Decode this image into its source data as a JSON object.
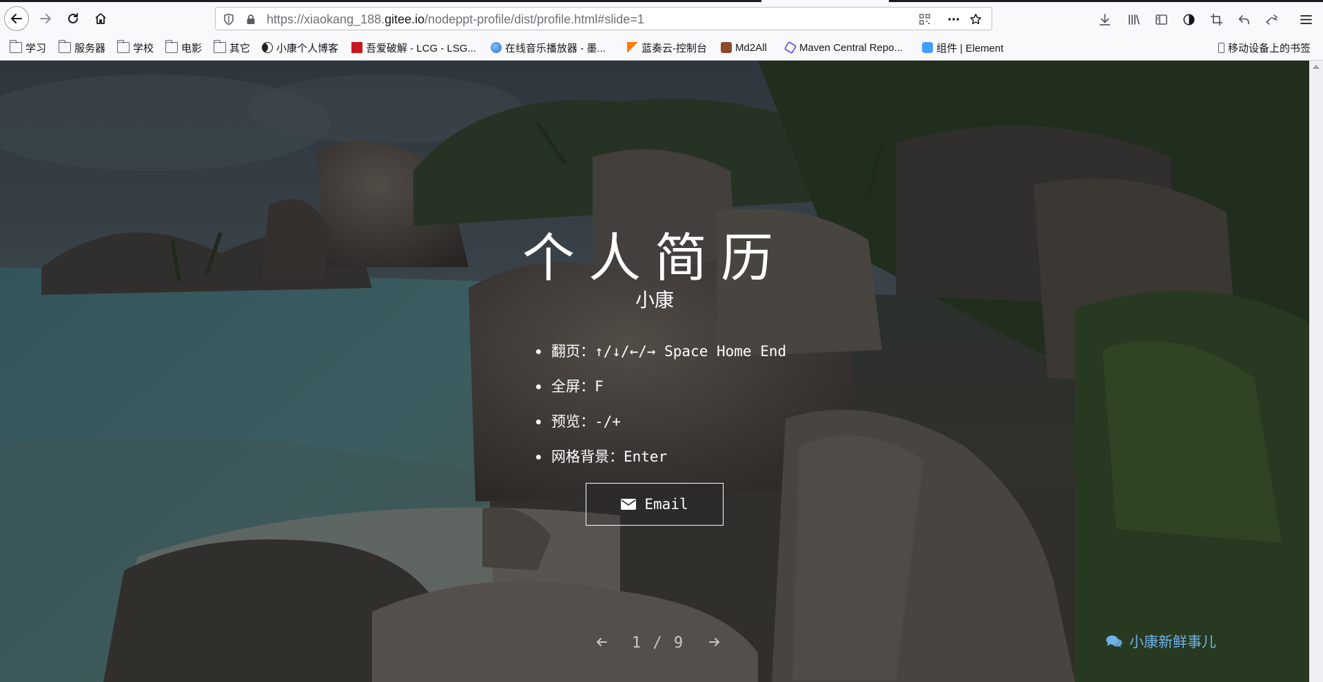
{
  "browser": {
    "url_prefix": "https://xiaokang_188.",
    "url_domain": "gitee.io",
    "url_path": "/nodeppt-profile/dist/profile.html#slide=1",
    "bookmarks": [
      {
        "label": "学习",
        "icon": "folder-icon"
      },
      {
        "label": "服务器",
        "icon": "folder-icon"
      },
      {
        "label": "学校",
        "icon": "folder-icon"
      },
      {
        "label": "电影",
        "icon": "folder-icon"
      },
      {
        "label": "其它",
        "icon": "folder-icon"
      },
      {
        "label": "小康个人博客",
        "icon": "blog-favicon"
      },
      {
        "label": "吾爱破解 - LCG - LSG...",
        "icon": "52pojie-favicon"
      },
      {
        "label": "在线音乐播放器 - 墨...",
        "icon": "globe-favicon"
      },
      {
        "label": "蓝奏云-控制台",
        "icon": "lanzou-favicon"
      },
      {
        "label": "Md2All",
        "icon": "md2all-favicon"
      },
      {
        "label": "Maven Central Repo...",
        "icon": "maven-favicon"
      },
      {
        "label": "组件 | Element",
        "icon": "element-favicon"
      }
    ],
    "mobile_bookmarks": "移动设备上的书签"
  },
  "slide": {
    "title": "个人简历",
    "subtitle": "小康",
    "tips": [
      "翻页：↑/↓/←/→ Space Home End",
      "全屏：F",
      "预览：-/+",
      "网格背景：Enter"
    ],
    "email_label": "Email",
    "page_indicator": "1 / 9",
    "footer_link": "小康新鲜事儿"
  }
}
